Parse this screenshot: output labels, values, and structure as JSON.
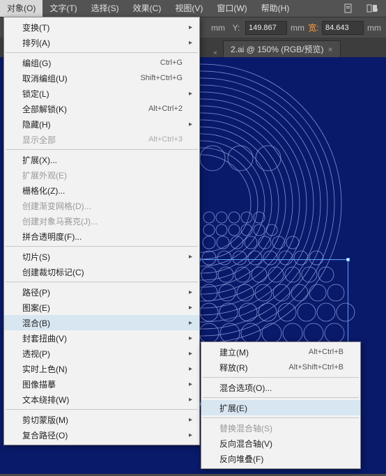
{
  "menubar": {
    "items": [
      {
        "label": "对象(O)",
        "active": true
      },
      {
        "label": "文字(T)"
      },
      {
        "label": "选择(S)"
      },
      {
        "label": "效果(C)"
      },
      {
        "label": "视图(V)"
      },
      {
        "label": "窗口(W)"
      },
      {
        "label": "帮助(H)"
      }
    ]
  },
  "toolbar": {
    "x_unit": "mm",
    "y_label": "Y:",
    "y_value": "149.867",
    "y_unit": "mm",
    "w_label": "宽:",
    "w_value": "84.643",
    "w_unit": "mm"
  },
  "tabs": {
    "close": "×",
    "items": [
      {
        "label": "2.ai @ 150% (RGB/预览)"
      }
    ]
  },
  "dropdown": [
    {
      "label": "变换(T)",
      "sub": true
    },
    {
      "label": "排列(A)",
      "sub": true
    },
    {
      "sep": true
    },
    {
      "label": "编组(G)",
      "shortcut": "Ctrl+G"
    },
    {
      "label": "取消编组(U)",
      "shortcut": "Shift+Ctrl+G"
    },
    {
      "label": "锁定(L)",
      "sub": true
    },
    {
      "label": "全部解锁(K)",
      "shortcut": "Alt+Ctrl+2"
    },
    {
      "label": "隐藏(H)",
      "sub": true
    },
    {
      "label": "显示全部",
      "shortcut": "Alt+Ctrl+3",
      "disabled": true
    },
    {
      "sep": true
    },
    {
      "label": "扩展(X)..."
    },
    {
      "label": "扩展外观(E)",
      "disabled": true
    },
    {
      "label": "栅格化(Z)..."
    },
    {
      "label": "创建渐变网格(D)...",
      "disabled": true
    },
    {
      "label": "创建对象马赛克(J)...",
      "disabled": true
    },
    {
      "label": "拼合透明度(F)..."
    },
    {
      "sep": true
    },
    {
      "label": "切片(S)",
      "sub": true
    },
    {
      "label": "创建裁切标记(C)"
    },
    {
      "sep": true
    },
    {
      "label": "路径(P)",
      "sub": true
    },
    {
      "label": "图案(E)",
      "sub": true
    },
    {
      "label": "混合(B)",
      "sub": true,
      "highlight": true
    },
    {
      "label": "封套扭曲(V)",
      "sub": true
    },
    {
      "label": "透视(P)",
      "sub": true
    },
    {
      "label": "实时上色(N)",
      "sub": true
    },
    {
      "label": "图像描摹",
      "sub": true
    },
    {
      "label": "文本绕排(W)",
      "sub": true
    },
    {
      "sep": true
    },
    {
      "label": "剪切蒙版(M)",
      "sub": true
    },
    {
      "label": "复合路径(O)",
      "sub": true
    }
  ],
  "submenu": [
    {
      "label": "建立(M)",
      "shortcut": "Alt+Ctrl+B"
    },
    {
      "label": "释放(R)",
      "shortcut": "Alt+Shift+Ctrl+B"
    },
    {
      "sep": true
    },
    {
      "label": "混合选项(O)..."
    },
    {
      "sep": true
    },
    {
      "label": "扩展(E)",
      "highlight": true
    },
    {
      "sep": true
    },
    {
      "label": "替换混合轴(S)",
      "disabled": true
    },
    {
      "label": "反向混合轴(V)"
    },
    {
      "label": "反向堆叠(F)"
    }
  ]
}
